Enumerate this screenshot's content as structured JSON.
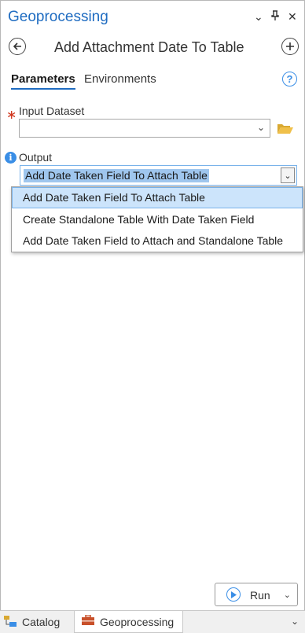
{
  "pane": {
    "title": "Geoprocessing",
    "controls": {
      "menu": "⌄",
      "pin": "⊥",
      "close": "✕"
    }
  },
  "tool": {
    "title": "Add Attachment Date To Table",
    "back_icon": "back-arrow-icon",
    "add_icon": "add-icon"
  },
  "tabs": [
    {
      "label": "Parameters",
      "active": true
    },
    {
      "label": "Environments",
      "active": false
    }
  ],
  "params": {
    "required_mark": "∗",
    "input_dataset": {
      "label": "Input Dataset",
      "value": ""
    },
    "output": {
      "label": "Output",
      "value": "Add Date Taken Field To Attach Table",
      "options": [
        "Add Date Taken Field To Attach Table",
        "Create Standalone Table With Date Taken Field",
        "Add Date Taken Field to Attach and Standalone Table"
      ]
    }
  },
  "run": {
    "label": "Run"
  },
  "bottom_tabs": [
    {
      "label": "Catalog",
      "active": false
    },
    {
      "label": "Geoprocessing",
      "active": true
    }
  ],
  "colors": {
    "accent": "#1f6cc1",
    "selection": "#9fc6ee",
    "required": "#d0351c"
  }
}
